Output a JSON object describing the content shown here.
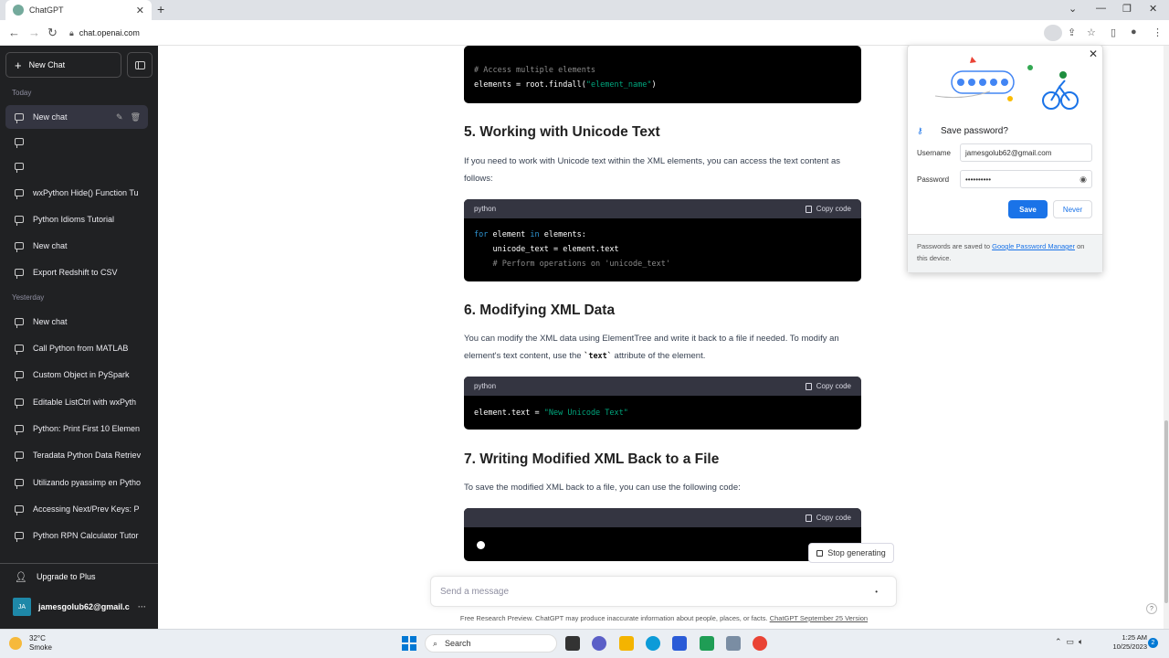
{
  "browser": {
    "tab_title": "ChatGPT",
    "url": "chat.openai.com"
  },
  "sidebar": {
    "new_chat_label": "New Chat",
    "today_label": "Today",
    "yesterday_label": "Yesterday",
    "today_items": [
      {
        "label": "New chat"
      },
      {
        "label": ""
      },
      {
        "label": ""
      },
      {
        "label": "wxPython Hide() Function Tu"
      },
      {
        "label": "Python Idioms Tutorial"
      },
      {
        "label": "New chat"
      },
      {
        "label": "Export Redshift to CSV"
      }
    ],
    "yesterday_items": [
      {
        "label": "New chat"
      },
      {
        "label": "Call Python from MATLAB"
      },
      {
        "label": "Custom Object in PySpark"
      },
      {
        "label": "Editable ListCtrl with wxPyth"
      },
      {
        "label": "Python: Print First 10 Elemen"
      },
      {
        "label": "Teradata Python Data Retriev"
      },
      {
        "label": "Utilizando pyassimp en Pytho"
      },
      {
        "label": "Accessing Next/Prev Keys: P"
      },
      {
        "label": "Python RPN Calculator Tutor"
      }
    ],
    "upgrade_label": "Upgrade to Plus",
    "user_initials": "JA",
    "user_email": "jamesgolub62@gmail.c"
  },
  "content": {
    "code0": {
      "comment": "# Access multiple elements",
      "line_prefix": "elements = root.findall(",
      "string": "\"element_name\"",
      "line_suffix": ")"
    },
    "section5_title": "5. Working with Unicode Text",
    "section5_text": "If you need to work with Unicode text within the XML elements, you can access the text content as follows:",
    "code1": {
      "lang": "python",
      "copy": "Copy code",
      "kw_for": "for",
      "var1": " element ",
      "kw_in": "in",
      "var2": " elements:",
      "line2": "    unicode_text = element.text",
      "line3": "    # Perform operations on 'unicode_text'"
    },
    "section6_title": "6. Modifying XML Data",
    "section6_text_a": "You can modify the XML data using ElementTree and write it back to a file if needed. To modify an element's text content, use the ",
    "section6_code": "`text`",
    "section6_text_b": " attribute of the element.",
    "code2": {
      "lang": "python",
      "copy": "Copy code",
      "prefix": "element.text = ",
      "string": "\"New Unicode Text\""
    },
    "section7_title": "7. Writing Modified XML Back to a File",
    "section7_text": "To save the modified XML back to a file, you can use the following code:",
    "code3": {
      "copy": "Copy code"
    },
    "stop_generating": "Stop generating",
    "message_placeholder": "Send a message",
    "footer_text": "Free Research Preview. ChatGPT may produce inaccurate information about people, places, or facts. ",
    "footer_link": "ChatGPT September 25 Version",
    "help": "?"
  },
  "password_popup": {
    "title": "Save password?",
    "username_label": "Username",
    "username_value": "jamesgolub62@gmail.com",
    "password_label": "Password",
    "password_value": "••••••••••",
    "save_label": "Save",
    "never_label": "Never",
    "footer_text_a": "Passwords are saved to ",
    "footer_link": "Google Password Manager",
    "footer_text_b": " on this device."
  },
  "taskbar": {
    "temperature": "32°C",
    "weather": "Smoke",
    "search_label": "Search",
    "time": "1:25 AM",
    "date": "10/25/2023",
    "notifications": "2"
  },
  "colors": {
    "sidebar_bg": "#202123",
    "accent_blue": "#1a73e8",
    "code_string": "#00a67d",
    "code_keyword": "#2e95d3"
  }
}
